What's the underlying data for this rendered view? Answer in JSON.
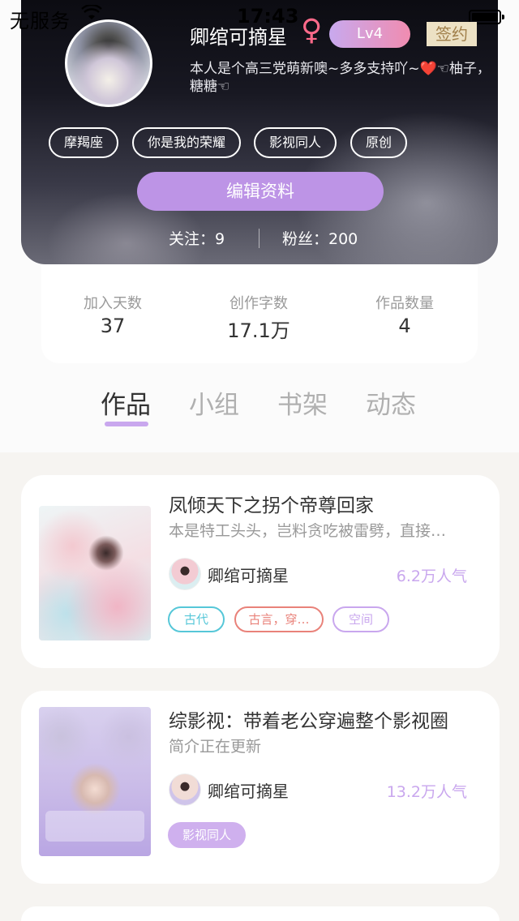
{
  "status_bar": {
    "carrier": "无服务",
    "wifi_icon": "wifi-icon",
    "time": "17:43",
    "battery_level": 1.0
  },
  "profile": {
    "username": "卿绾可摘星",
    "gender_icon": "♀",
    "level": "Lv4",
    "sign_badge": "签约",
    "bio_part1": "本人是个高三党萌新噢~多多支持吖~",
    "bio_heart": "❤️",
    "bio_part2": "☜柚子，糖糖☜",
    "tags": [
      "摩羯座",
      "你是我的荣耀",
      "影视同人",
      "原创"
    ],
    "edit_button": "编辑资料",
    "following": "关注：9",
    "fans": "粉丝：200"
  },
  "stats": [
    {
      "label": "加入天数",
      "value": "37"
    },
    {
      "label": "创作字数",
      "value": "17.1万"
    },
    {
      "label": "作品数量",
      "value": "4"
    }
  ],
  "tabs": [
    "作品",
    "小组",
    "书架",
    "动态"
  ],
  "works": [
    {
      "title": "凤倾天下之拐个帝尊回家",
      "description": "本是特工头头，岂料贪吃被雷劈，直接…",
      "author": "卿绾可摘星",
      "popularity": "6.2万人气",
      "tags": [
        "古代",
        "古言，穿…",
        "空间"
      ]
    },
    {
      "title": "综影视：带着老公穿遍整个影视圈",
      "description": "简介正在更新",
      "author": "卿绾可摘星",
      "popularity": "13.2万人气",
      "tags": [
        "影视同人"
      ]
    }
  ]
}
